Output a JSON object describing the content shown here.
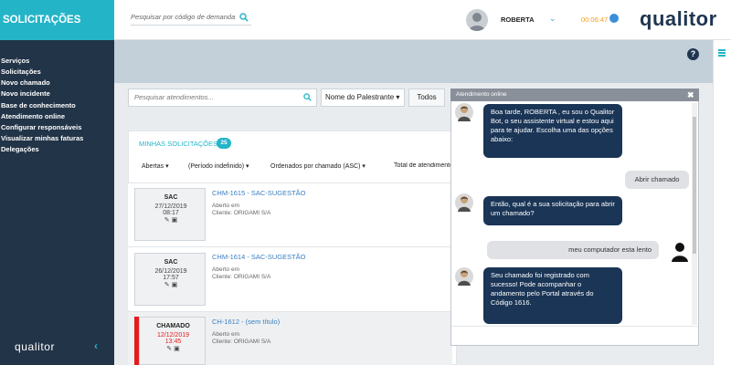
{
  "brand": {
    "title": "SOLICITAÇÕES"
  },
  "sidebar": {
    "items": [
      {
        "label": "Serviços"
      },
      {
        "label": "Solicitações"
      },
      {
        "label": "Novo chamado"
      },
      {
        "label": "Novo incidente"
      },
      {
        "label": "Base de conhecimento"
      },
      {
        "label": "Atendimento online"
      },
      {
        "label": "Configurar responsáveis"
      },
      {
        "label": "Visualizar minhas faturas"
      },
      {
        "label": "Delegações"
      }
    ],
    "logo": "qualitor",
    "collapse": "‹"
  },
  "header": {
    "search_placeholder": "Pesquisar por código de demanda",
    "user": "ROBERTA",
    "chevron": "⌄",
    "timer": "00:06:47",
    "logo": "qualitor"
  },
  "help": "?",
  "filters": {
    "search_placeholder": "Pesquisar atendimentos...",
    "speaker": "Nome do Palestrante ▾",
    "todos": "Todos",
    "status": "Abertas",
    "period": "(Período indefinido)",
    "order": "Ordenados por chamado (ASC)",
    "total": "Total de atendimentos"
  },
  "requests": {
    "title": "MINHAS SOLICITAÇÕES",
    "count": "25",
    "items": [
      {
        "type": "SAC",
        "date": "27/12/2019",
        "time": "08:17",
        "title": "CHM-1615 - SAC-SUGESTÃO",
        "status": "Aberto em",
        "client": "Cliente: ORIGAMI S/A",
        "accent": "#eef0f2",
        "date_color": "#444444"
      },
      {
        "type": "SAC",
        "date": "26/12/2019",
        "time": "17:57",
        "title": "CHM-1614 - SAC-SUGESTÃO",
        "status": "Aberto em",
        "client": "Cliente: ORIGAMI S/A",
        "accent": "#eef0f2",
        "date_color": "#444444"
      },
      {
        "type": "CHAMADO",
        "date": "12/12/2019",
        "time": "13:45",
        "title": "CH-1612 - (sem título)",
        "status": "Aberto em",
        "client": "Cliente: ORIGAMI S/A",
        "accent": "#e41b1b",
        "date_color": "#e41b1b"
      }
    ]
  },
  "chat": {
    "header": "Atendimento online",
    "close": "✖",
    "messages": [
      {
        "from": "bot",
        "text": "Boa tarde, ROBERTA , eu sou o Qualitor Bot, o seu assistente virtual e estou aqui para te ajudar. Escolha uma das opções abaixo:"
      },
      {
        "from": "user",
        "text": "Abrir chamado"
      },
      {
        "from": "bot",
        "text": "Então, qual é a sua solicitação para abrir um chamado?"
      },
      {
        "from": "user",
        "text": "meu computador esta lento"
      },
      {
        "from": "bot",
        "text": "Seu chamado foi registrado com sucesso! Pode acompanhar o andamento pelo Portal através do Código 1616."
      }
    ]
  },
  "colors": {
    "sidebar": "#223447",
    "brand": "#24b4c8",
    "accent_blue": "#24b4c8",
    "bot_bubble": "#1a3556",
    "user_bubble": "#dfe1e4",
    "timer": "#f39c12",
    "danger": "#e41b1b"
  }
}
